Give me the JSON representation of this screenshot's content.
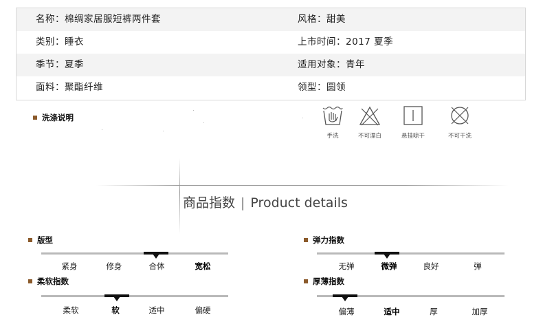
{
  "attributes": [
    {
      "left": "名称：棉绸家居服短裤两件套",
      "right": "风格：甜美"
    },
    {
      "left": "类别：睡衣",
      "right": "上市时间：2017 夏季"
    },
    {
      "left": "季节：夏季",
      "right": "适用对象：青年"
    },
    {
      "left": "面料：聚酯纤维",
      "right": "领型：圆领"
    }
  ],
  "wash": {
    "title": "洗涤说明",
    "icons": [
      {
        "icon": "hand-wash-icon",
        "label": "手洗"
      },
      {
        "icon": "no-bleach-icon",
        "label": "不可漂白"
      },
      {
        "icon": "hang-dry-icon",
        "label": "悬挂晾干"
      },
      {
        "icon": "no-dry-clean-icon",
        "label": "不可干洗"
      }
    ]
  },
  "details": {
    "title_cn": "商品指数",
    "separator": "|",
    "title_en": "Product details"
  },
  "indices": [
    {
      "title": "版型",
      "options": [
        "紧身",
        "修身",
        "合体",
        "宽松"
      ],
      "selected": 2,
      "bold": [
        3
      ]
    },
    {
      "title": "弹力指数",
      "options": [
        "无弹",
        "微弹",
        "良好",
        "弹"
      ],
      "selected": 1,
      "bold": [
        1
      ]
    },
    {
      "title": "柔软指数",
      "options": [
        "柔软",
        "软",
        "适中",
        "偏硬"
      ],
      "selected": 1,
      "bold": [
        1
      ]
    },
    {
      "title": "厚薄指数",
      "options": [
        "偏薄",
        "适中",
        "厚",
        "加厚"
      ],
      "selected": 0,
      "bold": [
        1
      ]
    }
  ],
  "colors": {
    "accent_square": "#8b5a2b",
    "row_shade": "#f3f3f3",
    "scale_bar": "#b9b9b9"
  }
}
